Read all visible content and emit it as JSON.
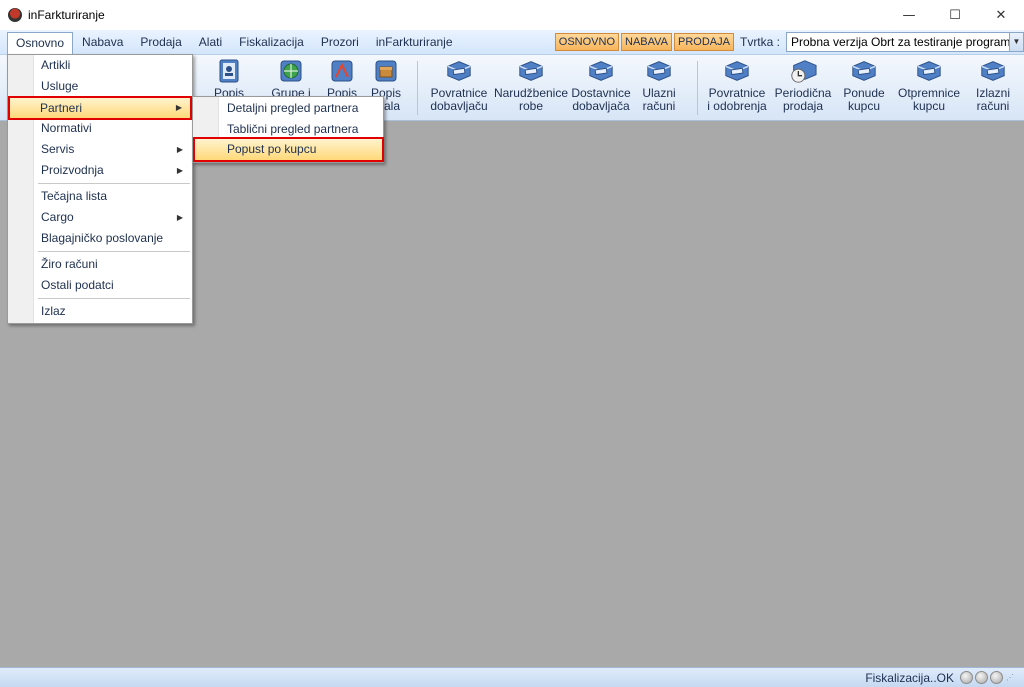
{
  "window": {
    "title": "inFarkturiranje",
    "minimize_glyph": "—",
    "maximize_glyph": "☐",
    "close_glyph": "✕"
  },
  "menubar": {
    "items": [
      "Osnovno",
      "Nabava",
      "Prodaja",
      "Alati",
      "Fiskalizacija",
      "Prozori",
      "inFarkturiranje"
    ],
    "modes": [
      "OSNOVNO",
      "NABAVA",
      "PRODAJA"
    ],
    "tvrtka_label": "Tvrtka :",
    "company_value": "Probna verzija Obrt za testiranje programa"
  },
  "toolbar": {
    "buttons": [
      {
        "label1": "Popis",
        "label2": "",
        "icon": "address-book-icon"
      },
      {
        "label1": "Grupe i",
        "label2": "",
        "icon": "globe-icon"
      },
      {
        "label1": "Popis",
        "label2": "",
        "icon": "chart-icon"
      },
      {
        "label1": "Popis",
        "label2": "skala",
        "icon": "box-icon"
      },
      {
        "label1": "Povratnice",
        "label2": "dobavljaču",
        "icon": "van-icon"
      },
      {
        "label1": "Narudžbenice",
        "label2": "robe",
        "icon": "van-icon"
      },
      {
        "label1": "Dostavnice",
        "label2": "dobavljača",
        "icon": "van-icon"
      },
      {
        "label1": "Ulazni",
        "label2": "računi",
        "icon": "van-icon"
      },
      {
        "label1": "Povratnice",
        "label2": "i odobrenja",
        "icon": "van-icon"
      },
      {
        "label1": "Periodična",
        "label2": "prodaja",
        "icon": "clock-van-icon"
      },
      {
        "label1": "Ponude",
        "label2": "kupcu",
        "icon": "van-icon"
      },
      {
        "label1": "Otpremnice",
        "label2": "kupcu",
        "icon": "van-icon"
      },
      {
        "label1": "Izlazni",
        "label2": "računi",
        "icon": "van-icon"
      }
    ]
  },
  "menu": {
    "items": [
      {
        "label": "Artikli"
      },
      {
        "label": "Usluge"
      },
      {
        "label": "Partneri"
      },
      {
        "label": "Normativi"
      },
      {
        "label": "Servis"
      },
      {
        "label": "Proizvodnja"
      },
      {
        "label": "Tečajna lista"
      },
      {
        "label": "Cargo"
      },
      {
        "label": "Blagajničko poslovanje"
      },
      {
        "label": "Žiro računi"
      },
      {
        "label": "Ostali podatci"
      },
      {
        "label": "Izlaz"
      }
    ],
    "submenu_arrow": "▶"
  },
  "submenu": {
    "items": [
      {
        "label": "Detaljni pregled partnera"
      },
      {
        "label": "Tablični pregled partnera"
      },
      {
        "label": "Popust po kupcu"
      }
    ]
  },
  "statusbar": {
    "text": "Fiskalizacija..OK",
    "grip": "⋰"
  },
  "colors": {
    "highlight_border": "#e00000",
    "workspace": "#a9a9a9",
    "mode_button": "#f7b55b"
  }
}
